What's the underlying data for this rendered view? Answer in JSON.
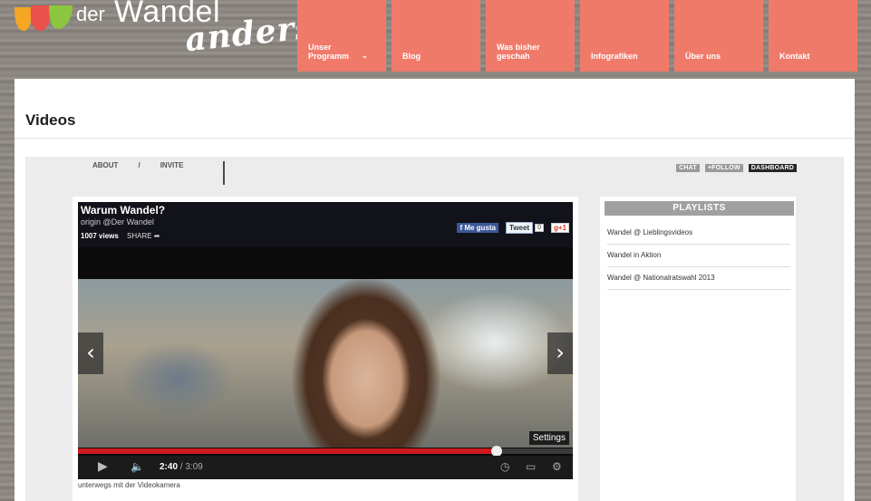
{
  "logo": {
    "der": "der",
    "wandel": "Wandel",
    "anders": "anders"
  },
  "nav": {
    "items": [
      {
        "label": "Unser Programm",
        "has_dropdown": true
      },
      {
        "label": "Blog"
      },
      {
        "label": "Was bisher geschah"
      },
      {
        "label": "Infografiken"
      },
      {
        "label": "Über uns"
      },
      {
        "label": "Kontakt"
      }
    ],
    "dropdown_glyph": "⌄",
    "color": "#f07a6a"
  },
  "page": {
    "title": "Videos"
  },
  "embed": {
    "links": {
      "about": "ABOUT",
      "separator": "/",
      "invite": "INVITE"
    },
    "tags": {
      "chat": "CHAT",
      "follow": "+FOLLOW",
      "dashboard": "DASHBOARD"
    }
  },
  "player": {
    "title": "Warum Wandel?",
    "origin": "origin @Der Wandel",
    "views": "1007 views",
    "share": "SHARE",
    "social": {
      "facebook": "Me gusta",
      "tweet": "Tweet",
      "tweet_count": "0",
      "gplus": "+1"
    },
    "settings_label": "Settings",
    "time_current": "2:40",
    "time_total": "/ 3:09",
    "progress": 0.8466,
    "caption": "unterwegs mit der Videokamera",
    "icons": {
      "prev": "chevron-left-icon",
      "next": "chevron-right-icon",
      "play": "play-icon",
      "volume": "volume-icon",
      "clock": "watch-later-icon",
      "size": "size-icon",
      "gear": "gear-icon"
    },
    "progress_color": "#cc181e"
  },
  "playlists": {
    "heading": "PLAYLISTS",
    "items": [
      "Wandel @ Lieblingsvideos",
      "Wandel in Aktion",
      "Wandel @ Nationalratswahl 2013"
    ]
  }
}
